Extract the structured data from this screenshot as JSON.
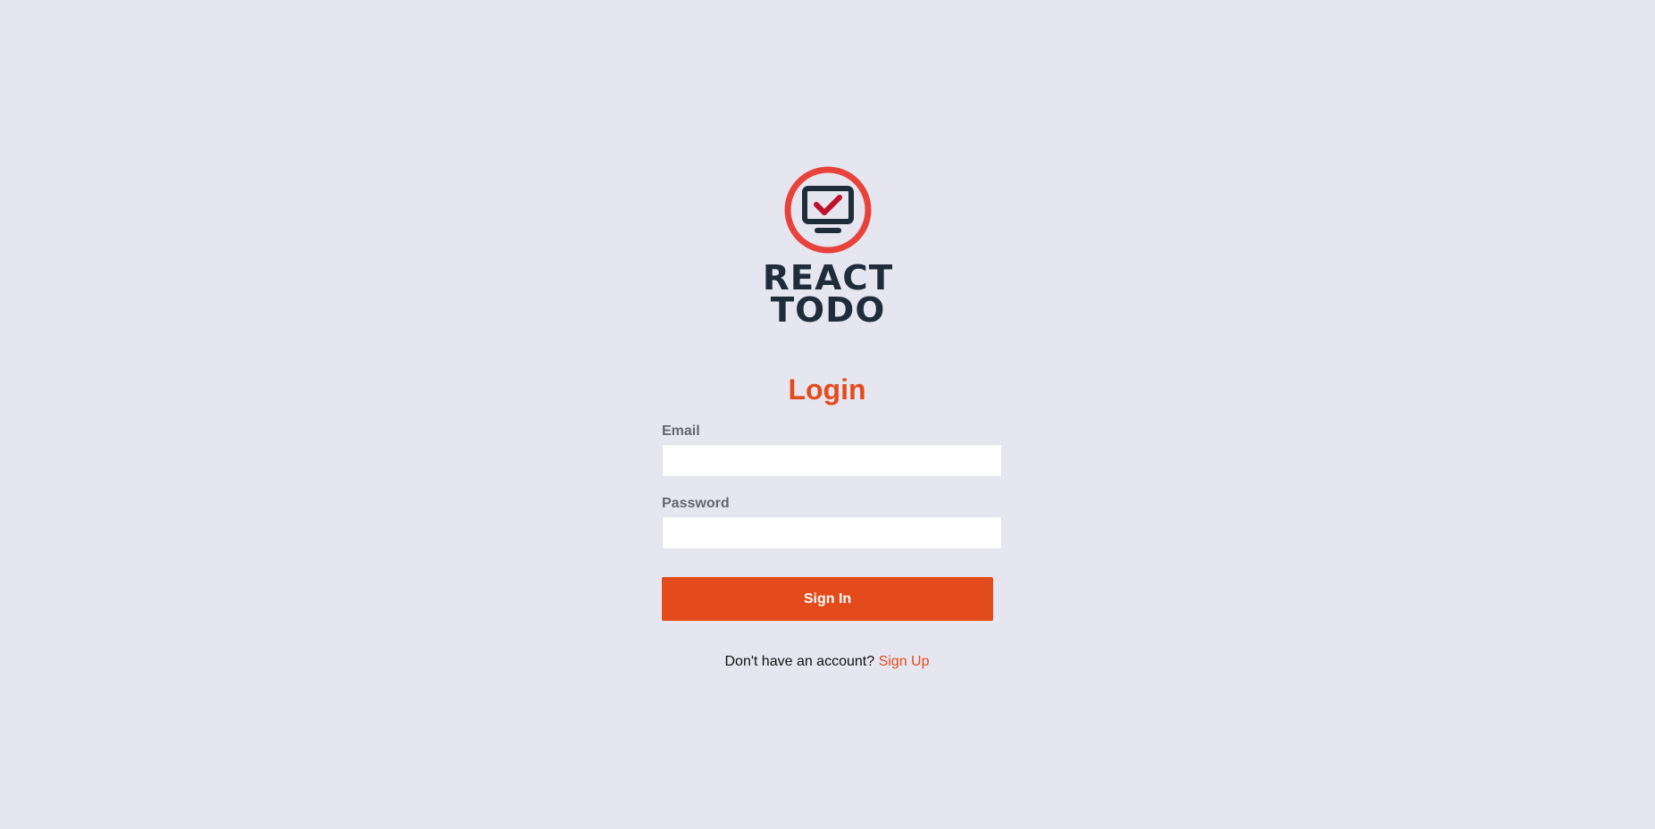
{
  "brand": {
    "line1": "REACT",
    "line2": "TODO",
    "icon": "monitor-check-icon",
    "ring_color": "#e8433a",
    "dark_color": "#1f2d3a",
    "check_color": "#c0102a"
  },
  "login": {
    "title": "Login",
    "email_label": "Email",
    "email_value": "",
    "password_label": "Password",
    "password_value": "",
    "submit_label": "Sign In",
    "signup_prompt": "Don't have an account?",
    "signup_link": "Sign Up"
  },
  "colors": {
    "accent": "#e44b1c",
    "background": "#e6e6f0",
    "label": "#666670"
  }
}
